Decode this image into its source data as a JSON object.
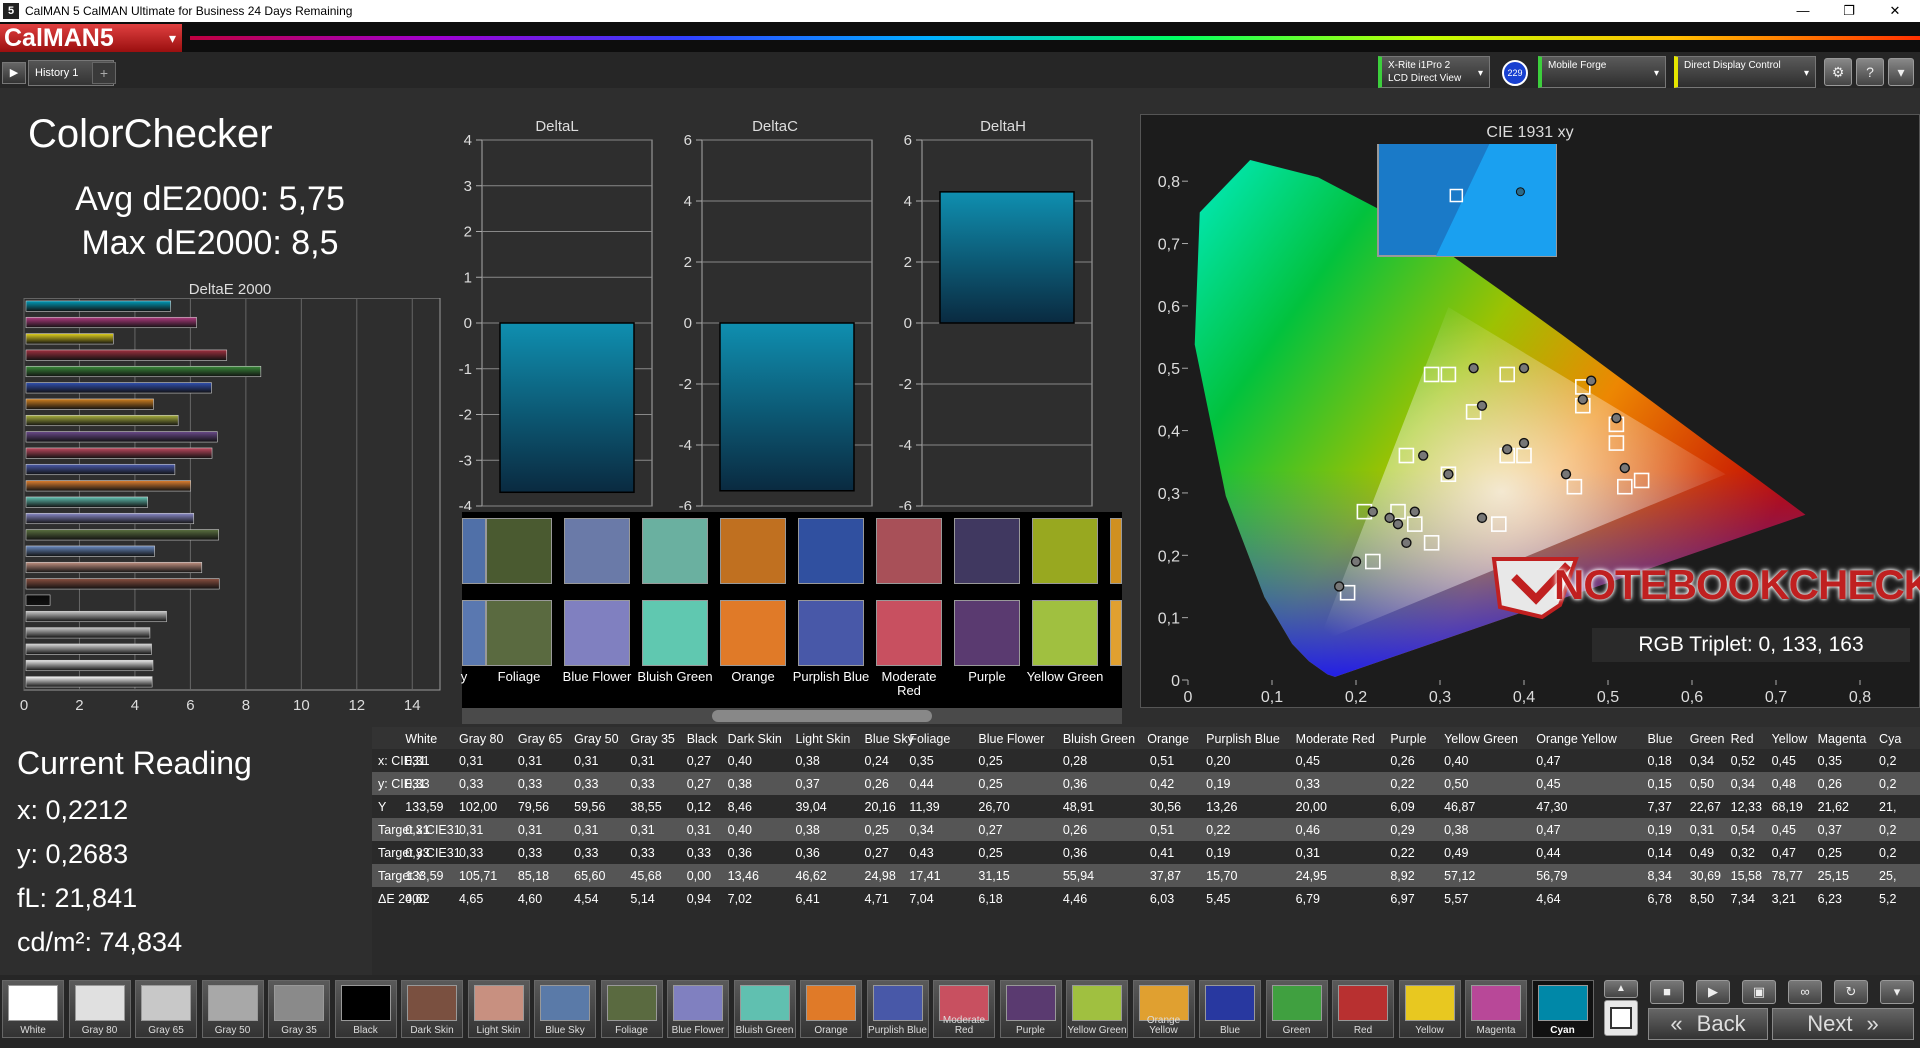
{
  "window": {
    "icon": "5",
    "title": "CalMAN 5 CalMAN Ultimate for Business 24 Days Remaining",
    "minimize": "—",
    "restore": "❐",
    "close": "✕"
  },
  "app": {
    "logo": "CalMAN5",
    "logo_caret": "▾"
  },
  "tabs": [
    {
      "label": "History 1"
    }
  ],
  "add_tab": "+",
  "play": "▶",
  "devices": [
    {
      "line1": "X-Rite i1Pro 2",
      "line2": "LCD Direct View",
      "accent": "#3ccf3c"
    },
    {
      "badge": "229"
    },
    {
      "line1": "Mobile Forge",
      "line2": "",
      "accent": "#3ccf3c"
    },
    {
      "line1": "Direct Display Control",
      "line2": "",
      "accent": "#e6e600"
    }
  ],
  "toolbar_icons": [
    "gear-icon",
    "help-icon",
    "chevron-down-icon"
  ],
  "toolbar_glyphs": {
    "gear": "⚙",
    "help": "?",
    "caret": "▾"
  },
  "colorchecker": {
    "title": "ColorChecker",
    "avg": "Avg dE2000: 5,75",
    "max": "Max dE2000: 8,5"
  },
  "deltae_chart": {
    "type": "bar",
    "title": "DeltaE 2000",
    "xticks": [
      "0",
      "2",
      "4",
      "6",
      "8",
      "10",
      "12",
      "14"
    ],
    "xlim": [
      0,
      15
    ],
    "values": [
      5.29,
      6.22,
      3.22,
      7.31,
      8.54,
      6.76,
      4.67,
      5.56,
      6.97,
      6.78,
      5.44,
      6.01,
      4.46,
      6.12,
      7.02,
      4.71,
      6.41,
      7.04,
      0.94,
      5.14,
      4.54,
      4.6,
      4.65,
      4.62
    ],
    "colors": [
      "#009bb8",
      "#b03c80",
      "#e0d020",
      "#a03040",
      "#3a8a3a",
      "#3050b0",
      "#d08020",
      "#a8b040",
      "#6a4a8a",
      "#c04a60",
      "#4a5aaa",
      "#e08030",
      "#60c0b0",
      "#8a8ac8",
      "#5a7040",
      "#6a8ac0",
      "#c09080",
      "#8a5040",
      "#080808",
      "#c8c8c8",
      "#c8c8c8",
      "#d8d8d8",
      "#e8e8e8",
      "#f8f8f8"
    ]
  },
  "delta_charts": [
    {
      "type": "bar",
      "title": "DeltaL",
      "yticks": [
        "4",
        "3",
        "2",
        "1",
        "0",
        "-1",
        "-2",
        "-3",
        "-4"
      ],
      "ylim": [
        -4,
        4
      ],
      "value": -3.7
    },
    {
      "type": "bar",
      "title": "DeltaC",
      "yticks": [
        "6",
        "4",
        "2",
        "0",
        "-2",
        "-4",
        "-6"
      ],
      "ylim": [
        -6,
        6
      ],
      "value": -5.5
    },
    {
      "type": "bar",
      "title": "DeltaH",
      "yticks": [
        "6",
        "4",
        "2",
        "0",
        "-2",
        "-4",
        "-6"
      ],
      "ylim": [
        -6,
        6
      ],
      "value": 4.3
    }
  ],
  "swatches": [
    {
      "label": "y",
      "actual": "#5070a8",
      "target": "#5a78b0"
    },
    {
      "label": "Foliage",
      "actual": "#4a5a30",
      "target": "#5a6a40"
    },
    {
      "label": "Blue Flower",
      "actual": "#6a7aa8",
      "target": "#8080c0"
    },
    {
      "label": "Bluish Green",
      "actual": "#6ab0a0",
      "target": "#60c8b0"
    },
    {
      "label": "Orange",
      "actual": "#c07020",
      "target": "#e07a28"
    },
    {
      "label": "Purplish Blue",
      "actual": "#3050a0",
      "target": "#4858a8"
    },
    {
      "label": "Moderate Red",
      "actual": "#a85058",
      "target": "#c85060"
    },
    {
      "label": "Purple",
      "actual": "#403860",
      "target": "#5a3a70"
    },
    {
      "label": "Yellow Green",
      "actual": "#98a820",
      "target": "#a0c040"
    },
    {
      "label": "",
      "actual": "#d09020",
      "target": "#e0a030"
    }
  ],
  "cie": {
    "type": "scatter",
    "title": "CIE 1931 xy",
    "xticks": [
      "0",
      "0,1",
      "0,2",
      "0,3",
      "0,4",
      "0,5",
      "0,6",
      "0,7",
      "0,8"
    ],
    "yticks": [
      "0",
      "0,1",
      "0,2",
      "0,3",
      "0,4",
      "0,5",
      "0,6",
      "0,7",
      "0,8"
    ],
    "xlim": [
      0,
      0.8
    ],
    "ylim": [
      0,
      0.85
    ],
    "gamut": [
      [
        0.31,
        0.598
      ],
      [
        0.64,
        0.33
      ],
      [
        0.155,
        0.06
      ]
    ],
    "targets": [
      [
        0.31,
        0.33
      ],
      [
        0.4,
        0.36
      ],
      [
        0.38,
        0.36
      ],
      [
        0.25,
        0.27
      ],
      [
        0.34,
        0.43
      ],
      [
        0.27,
        0.25
      ],
      [
        0.26,
        0.36
      ],
      [
        0.51,
        0.41
      ],
      [
        0.22,
        0.19
      ],
      [
        0.46,
        0.31
      ],
      [
        0.29,
        0.22
      ],
      [
        0.38,
        0.49
      ],
      [
        0.47,
        0.44
      ],
      [
        0.19,
        0.14
      ],
      [
        0.31,
        0.49
      ],
      [
        0.54,
        0.32
      ],
      [
        0.47,
        0.47
      ],
      [
        0.37,
        0.25
      ],
      [
        0.21,
        0.27
      ],
      [
        0.29,
        0.49
      ],
      [
        0.51,
        0.38
      ],
      [
        0.52,
        0.31
      ]
    ],
    "actuals": [
      [
        0.31,
        0.33
      ],
      [
        0.4,
        0.38
      ],
      [
        0.38,
        0.37
      ],
      [
        0.24,
        0.26
      ],
      [
        0.35,
        0.44
      ],
      [
        0.25,
        0.25
      ],
      [
        0.28,
        0.36
      ],
      [
        0.51,
        0.42
      ],
      [
        0.2,
        0.19
      ],
      [
        0.45,
        0.33
      ],
      [
        0.26,
        0.22
      ],
      [
        0.4,
        0.5
      ],
      [
        0.47,
        0.45
      ],
      [
        0.18,
        0.15
      ],
      [
        0.34,
        0.5
      ],
      [
        0.52,
        0.34
      ],
      [
        0.48,
        0.48
      ],
      [
        0.35,
        0.26
      ],
      [
        0.22,
        0.27
      ],
      [
        0.27,
        0.27
      ]
    ],
    "inset_target": [
      0.44,
      0.52
    ],
    "inset_actual": [
      0.8,
      0.49
    ]
  },
  "watermark": "NOTEBOOKCHECK",
  "rgb_triplet": "RGB Triplet: 0, 133, 163",
  "current": {
    "title": "Current Reading",
    "x": "x: 0,2212",
    "y": "y: 0,2683",
    "fl": "fL: 21,841",
    "cd": "cd/m²: 74,834"
  },
  "table": {
    "headers": [
      "",
      "White",
      "Gray 80",
      "Gray 65",
      "Gray 50",
      "Gray 35",
      "Black",
      "Dark Skin",
      "Light Skin",
      "Blue Sky",
      "Foliage",
      "Blue Flower",
      "Bluish Green",
      "Orange",
      "Purplish Blue",
      "Moderate Red",
      "Purple",
      "Yellow Green",
      "Orange Yellow",
      "Blue",
      "Green",
      "Red",
      "Yellow",
      "Magenta",
      "Cya"
    ],
    "rows": [
      [
        "x: CIE31",
        "0,31",
        "0,31",
        "0,31",
        "0,31",
        "0,31",
        "0,27",
        "0,40",
        "0,38",
        "0,24",
        "0,35",
        "0,25",
        "0,28",
        "0,51",
        "0,20",
        "0,45",
        "0,26",
        "0,40",
        "0,47",
        "0,18",
        "0,34",
        "0,52",
        "0,45",
        "0,35",
        "0,2"
      ],
      [
        "y: CIE31",
        "0,33",
        "0,33",
        "0,33",
        "0,33",
        "0,33",
        "0,27",
        "0,38",
        "0,37",
        "0,26",
        "0,44",
        "0,25",
        "0,36",
        "0,42",
        "0,19",
        "0,33",
        "0,22",
        "0,50",
        "0,45",
        "0,15",
        "0,50",
        "0,34",
        "0,48",
        "0,26",
        "0,2"
      ],
      [
        "Y",
        "133,59",
        "102,00",
        "79,56",
        "59,56",
        "38,55",
        "0,12",
        "8,46",
        "39,04",
        "20,16",
        "11,39",
        "26,70",
        "48,91",
        "30,56",
        "13,26",
        "20,00",
        "6,09",
        "46,87",
        "47,30",
        "7,37",
        "22,67",
        "12,33",
        "68,19",
        "21,62",
        "21,"
      ],
      [
        "Target x:CIE31",
        "0,31",
        "0,31",
        "0,31",
        "0,31",
        "0,31",
        "0,31",
        "0,40",
        "0,38",
        "0,25",
        "0,34",
        "0,27",
        "0,26",
        "0,51",
        "0,22",
        "0,46",
        "0,29",
        "0,38",
        "0,47",
        "0,19",
        "0,31",
        "0,54",
        "0,45",
        "0,37",
        "0,2"
      ],
      [
        "Target y:CIE31",
        "0,33",
        "0,33",
        "0,33",
        "0,33",
        "0,33",
        "0,33",
        "0,36",
        "0,36",
        "0,27",
        "0,43",
        "0,25",
        "0,36",
        "0,41",
        "0,19",
        "0,31",
        "0,22",
        "0,49",
        "0,44",
        "0,14",
        "0,49",
        "0,32",
        "0,47",
        "0,25",
        "0,2"
      ],
      [
        "Target Y",
        "133,59",
        "105,71",
        "85,18",
        "65,60",
        "45,68",
        "0,00",
        "13,46",
        "46,62",
        "24,98",
        "17,41",
        "31,15",
        "55,94",
        "37,87",
        "15,70",
        "24,95",
        "8,92",
        "57,12",
        "56,79",
        "8,34",
        "30,69",
        "15,58",
        "78,77",
        "25,15",
        "25,"
      ],
      [
        "ΔE 2000",
        "4,62",
        "4,65",
        "4,60",
        "4,54",
        "5,14",
        "0,94",
        "7,02",
        "6,41",
        "4,71",
        "7,04",
        "6,18",
        "4,46",
        "6,03",
        "5,45",
        "6,79",
        "6,97",
        "5,57",
        "4,64",
        "6,78",
        "8,50",
        "7,34",
        "3,21",
        "6,23",
        "5,2"
      ]
    ]
  },
  "palette": [
    {
      "label": "White",
      "color": "#ffffff"
    },
    {
      "label": "Gray 80",
      "color": "#e0e0e0"
    },
    {
      "label": "Gray 65",
      "color": "#c8c8c8"
    },
    {
      "label": "Gray 50",
      "color": "#a8a8a8"
    },
    {
      "label": "Gray 35",
      "color": "#8a8a8a"
    },
    {
      "label": "Black",
      "color": "#000000"
    },
    {
      "label": "Dark Skin",
      "color": "#7a5040"
    },
    {
      "label": "Light Skin",
      "color": "#c89080"
    },
    {
      "label": "Blue Sky",
      "color": "#5a7aa8"
    },
    {
      "label": "Foliage",
      "color": "#5a6a40"
    },
    {
      "label": "Blue Flower",
      "color": "#8080c0"
    },
    {
      "label": "Bluish Green",
      "color": "#60c0b0"
    },
    {
      "label": "Orange",
      "color": "#e07a28"
    },
    {
      "label": "Purplish Blue",
      "color": "#4858a8"
    },
    {
      "label": "Moderate Red",
      "color": "#c85060"
    },
    {
      "label": "Purple",
      "color": "#5a3a70"
    },
    {
      "label": "Yellow Green",
      "color": "#a0c040"
    },
    {
      "label": "Orange Yellow",
      "color": "#e0a030"
    },
    {
      "label": "Blue",
      "color": "#2838a0"
    },
    {
      "label": "Green",
      "color": "#40a040"
    },
    {
      "label": "Red",
      "color": "#b83030"
    },
    {
      "label": "Yellow",
      "color": "#e8c820"
    },
    {
      "label": "Magenta",
      "color": "#b84898"
    },
    {
      "label": "Cyan",
      "color": "#0088a8",
      "active": true
    }
  ],
  "nav": {
    "back": "Back",
    "next": "Next",
    "back_arrows": "«",
    "next_arrows": "»"
  },
  "controls": {
    "stop": "■",
    "play": "▶",
    "save": "▣",
    "loop": "∞",
    "refresh": "↻",
    "more": "▾",
    "up": "▲"
  }
}
